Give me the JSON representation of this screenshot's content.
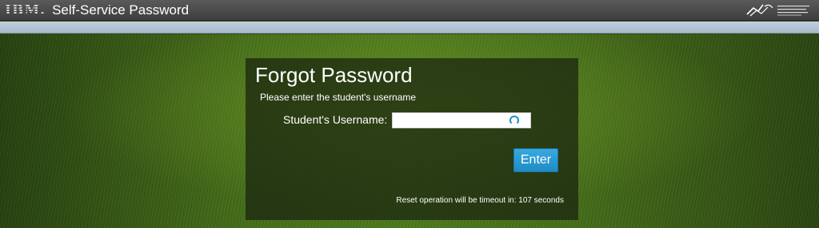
{
  "header": {
    "ibm_logo_text": "IBM.",
    "app_title": "Self-Service Password",
    "org_logo_icon": "organization-logo-icon"
  },
  "panel": {
    "title": "Forgot Password",
    "instruction": "Please enter the student's username",
    "username_label": "Student's Username:",
    "username_value": "",
    "loading_icon": "spinner-icon",
    "enter_label": "Enter",
    "timeout_text": "Reset operation will be timeout in: 107 seconds"
  },
  "colors": {
    "topbar": "#4a4a4a",
    "strip": "#b6c4d6",
    "button": "#2a9ad4",
    "background": "#4e7c1b"
  }
}
